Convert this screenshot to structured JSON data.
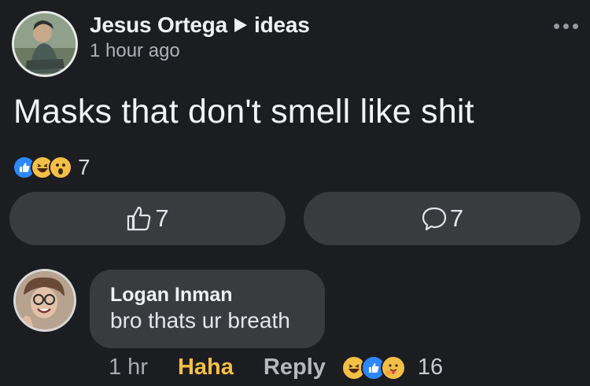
{
  "post": {
    "author": "Jesus Ortega",
    "group": "ideas",
    "time": "1 hour ago",
    "text": "Masks that don't smell like shit",
    "reaction_count": "7",
    "like_count": "7",
    "comment_count": "7"
  },
  "comment": {
    "author": "Logan Inman",
    "text": "bro thats ur breath",
    "time": "1 hr",
    "reaction_label": "Haha",
    "reply_label": "Reply",
    "reaction_count": "16"
  },
  "colors": {
    "background": "#1c1d21",
    "surface": "#3a3b3f",
    "like_blue": "#2d88ff",
    "haha_yellow": "#f4bf45"
  }
}
